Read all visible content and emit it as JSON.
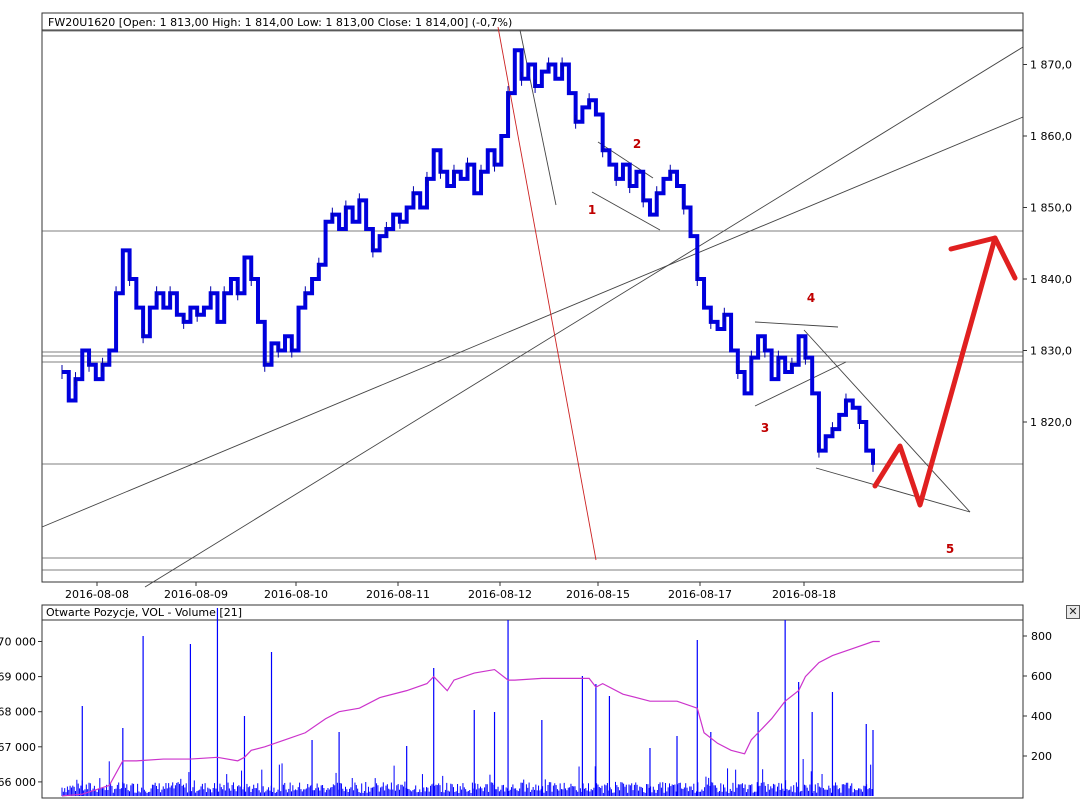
{
  "window": {
    "close_glyph": "✕",
    "close_icon": "close-icon"
  },
  "chart_data": [
    {
      "type": "line",
      "title": "FW20U1620 [Open: 1 813,00  High: 1 814,00  Low: 1 813,00  Close: 1 814,00] (-0,7%)",
      "xlabel": "",
      "ylabel": "",
      "x_tick_labels": [
        "2016-08-08",
        "2016-08-09",
        "2016-08-10",
        "2016-08-11",
        "2016-08-12",
        "2016-08-15",
        "2016-08-17",
        "2016-08-18"
      ],
      "y_ticks": [
        1870,
        1860,
        1850,
        1840,
        1830,
        1820
      ],
      "y_tick_labels": [
        "1 870,0",
        "1 860,0",
        "1 850,0",
        "1 840,0",
        "1 830,0",
        "1 820,0"
      ],
      "ylim": [
        1790,
        1876
      ],
      "xlim": [
        0,
        100
      ],
      "grid": false,
      "price_color": "#0000dd",
      "series": [
        {
          "values": [
            [
              1,
              1827
            ],
            [
              2,
              1823
            ],
            [
              3,
              1826
            ],
            [
              4,
              1830
            ],
            [
              5,
              1828
            ],
            [
              6,
              1826
            ],
            [
              7,
              1828
            ],
            [
              8,
              1830
            ],
            [
              9,
              1838
            ],
            [
              10,
              1844
            ],
            [
              11,
              1840
            ],
            [
              12,
              1836
            ],
            [
              13,
              1832
            ],
            [
              14,
              1836
            ],
            [
              15,
              1838
            ],
            [
              16,
              1836
            ],
            [
              17,
              1838
            ],
            [
              18,
              1835
            ],
            [
              19,
              1834
            ],
            [
              20,
              1836
            ],
            [
              21,
              1835
            ],
            [
              22,
              1836
            ],
            [
              23,
              1838
            ],
            [
              24,
              1834
            ],
            [
              25,
              1838
            ],
            [
              26,
              1840
            ],
            [
              27,
              1838
            ],
            [
              28,
              1843
            ],
            [
              29,
              1840
            ],
            [
              30,
              1834
            ],
            [
              31,
              1828
            ],
            [
              32,
              1831
            ],
            [
              33,
              1830
            ],
            [
              34,
              1832
            ],
            [
              35,
              1830
            ],
            [
              36,
              1836
            ],
            [
              37,
              1838
            ],
            [
              38,
              1840
            ],
            [
              39,
              1842
            ],
            [
              40,
              1848
            ],
            [
              41,
              1849
            ],
            [
              42,
              1847
            ],
            [
              43,
              1850
            ],
            [
              44,
              1848
            ],
            [
              45,
              1851
            ],
            [
              46,
              1847
            ],
            [
              47,
              1844
            ],
            [
              48,
              1846
            ],
            [
              49,
              1847
            ],
            [
              50,
              1849
            ],
            [
              51,
              1848
            ],
            [
              52,
              1850
            ],
            [
              53,
              1852
            ],
            [
              54,
              1850
            ],
            [
              55,
              1854
            ],
            [
              56,
              1858
            ],
            [
              57,
              1855
            ],
            [
              58,
              1853
            ],
            [
              59,
              1855
            ],
            [
              60,
              1854
            ],
            [
              61,
              1856
            ],
            [
              62,
              1852
            ],
            [
              63,
              1855
            ],
            [
              64,
              1858
            ],
            [
              65,
              1856
            ],
            [
              66,
              1860
            ],
            [
              67,
              1866
            ],
            [
              68,
              1872
            ],
            [
              69,
              1868
            ],
            [
              70,
              1870
            ],
            [
              71,
              1867
            ],
            [
              72,
              1869
            ],
            [
              73,
              1870
            ],
            [
              74,
              1868
            ],
            [
              75,
              1870
            ],
            [
              76,
              1866
            ],
            [
              77,
              1862
            ],
            [
              78,
              1864
            ],
            [
              79,
              1865
            ],
            [
              80,
              1863
            ],
            [
              81,
              1858
            ],
            [
              82,
              1856
            ],
            [
              83,
              1854
            ],
            [
              84,
              1856
            ],
            [
              85,
              1853
            ],
            [
              86,
              1855
            ],
            [
              87,
              1851
            ],
            [
              88,
              1849
            ],
            [
              89,
              1852
            ],
            [
              90,
              1854
            ],
            [
              91,
              1855
            ],
            [
              92,
              1853
            ],
            [
              93,
              1850
            ],
            [
              94,
              1846
            ],
            [
              95,
              1840
            ],
            [
              96,
              1836
            ],
            [
              97,
              1834
            ],
            [
              98,
              1833
            ],
            [
              99,
              1835
            ],
            [
              100,
              1830
            ],
            [
              101,
              1827
            ],
            [
              102,
              1824
            ],
            [
              103,
              1829
            ],
            [
              104,
              1832
            ],
            [
              105,
              1830
            ],
            [
              106,
              1826
            ],
            [
              107,
              1829
            ],
            [
              108,
              1827
            ],
            [
              109,
              1828
            ],
            [
              110,
              1832
            ],
            [
              111,
              1829
            ],
            [
              112,
              1824
            ],
            [
              113,
              1816
            ],
            [
              114,
              1818
            ],
            [
              115,
              1819
            ],
            [
              116,
              1821
            ],
            [
              117,
              1823
            ],
            [
              118,
              1822
            ],
            [
              119,
              1820
            ],
            [
              120,
              1816
            ],
            [
              121,
              1814
            ]
          ]
        }
      ],
      "annotations": [
        {
          "label": "1",
          "x": 83.0,
          "y": 1849.5
        },
        {
          "label": "2",
          "x": 88.0,
          "y": 1858.5
        },
        {
          "label": "3",
          "x": 108.0,
          "y": 1819.5
        },
        {
          "label": "4",
          "x": 113.5,
          "y": 1836.5
        },
        {
          "label": "5",
          "x": 133.5,
          "y": 1805.5
        }
      ],
      "annotation_color": "#c00000",
      "forecast_color": "#e02020",
      "forecast": [
        [
          121.5,
          1811
        ],
        [
          125,
          1817.5
        ],
        [
          128.5,
          1809
        ],
        [
          138,
          1845.5
        ]
      ],
      "forecast_arrowhead": [
        [
          132.5,
          1844
        ],
        [
          138,
          1845.5
        ],
        [
          140.5,
          1840
        ]
      ]
    },
    {
      "type": "line",
      "title": "Otwarte Pozycje, VOL - Volume [21]",
      "xlabel": "",
      "ylabel": "",
      "y_left_ticks": [
        70000,
        69000,
        68000,
        67000,
        66000
      ],
      "y_left_tick_labels": [
        "70 000",
        "69 000",
        "68 000",
        "67 000",
        "66 000"
      ],
      "y_left_lim": [
        65520,
        70500
      ],
      "y_right_ticks": [
        800,
        600,
        400,
        200
      ],
      "y_right_tick_labels": [
        "800",
        "600",
        "400",
        "200"
      ],
      "y_right_lim": [
        0,
        980
      ],
      "grid": false,
      "series": [
        {
          "name": "Otwarte Pozycje",
          "color": "#cc33cc",
          "axis": "left",
          "values": [
            [
              1,
              65600
            ],
            [
              4,
              65650
            ],
            [
              8,
              65900
            ],
            [
              10,
              66600
            ],
            [
              12,
              66600
            ],
            [
              16,
              66650
            ],
            [
              20,
              66650
            ],
            [
              24,
              66700
            ],
            [
              27,
              66600
            ],
            [
              28,
              66700
            ],
            [
              29,
              66900
            ],
            [
              31,
              67000
            ],
            [
              34,
              67200
            ],
            [
              37,
              67400
            ],
            [
              40,
              67800
            ],
            [
              42,
              68000
            ],
            [
              45,
              68100
            ],
            [
              48,
              68400
            ],
            [
              52,
              68600
            ],
            [
              55,
              68800
            ],
            [
              56,
              69000
            ],
            [
              58,
              68600
            ],
            [
              59,
              68900
            ],
            [
              62,
              69100
            ],
            [
              65,
              69200
            ],
            [
              67,
              68900
            ],
            [
              68,
              68900
            ],
            [
              72,
              68950
            ],
            [
              76,
              68950
            ],
            [
              79,
              68950
            ],
            [
              80,
              68700
            ],
            [
              81,
              68800
            ],
            [
              84,
              68500
            ],
            [
              88,
              68300
            ],
            [
              92,
              68300
            ],
            [
              95,
              68100
            ],
            [
              96,
              67400
            ],
            [
              98,
              67100
            ],
            [
              100,
              66900
            ],
            [
              102,
              66800
            ],
            [
              103,
              67200
            ],
            [
              104,
              67400
            ],
            [
              106,
              67800
            ],
            [
              108,
              68300
            ],
            [
              110,
              68600
            ],
            [
              111,
              69000
            ],
            [
              113,
              69400
            ],
            [
              115,
              69600
            ],
            [
              118,
              69800
            ],
            [
              121,
              70000
            ],
            [
              122,
              70000
            ]
          ]
        },
        {
          "name": "VOL",
          "color": "#0000ff",
          "axis": "right",
          "spikes": [
            [
              4,
              450
            ],
            [
              10,
              340
            ],
            [
              13,
              800
            ],
            [
              20,
              760
            ],
            [
              24,
              940
            ],
            [
              28,
              400
            ],
            [
              32,
              720
            ],
            [
              38,
              280
            ],
            [
              42,
              320
            ],
            [
              52,
              250
            ],
            [
              56,
              640
            ],
            [
              62,
              430
            ],
            [
              65,
              420
            ],
            [
              67,
              880
            ],
            [
              72,
              380
            ],
            [
              78,
              600
            ],
            [
              80,
              560
            ],
            [
              82,
              500
            ],
            [
              88,
              240
            ],
            [
              92,
              300
            ],
            [
              95,
              780
            ],
            [
              97,
              320
            ],
            [
              104,
              420
            ],
            [
              108,
              880
            ],
            [
              110,
              570
            ],
            [
              112,
              420
            ],
            [
              115,
              520
            ],
            [
              120,
              360
            ],
            [
              121,
              330
            ]
          ]
        }
      ]
    }
  ]
}
